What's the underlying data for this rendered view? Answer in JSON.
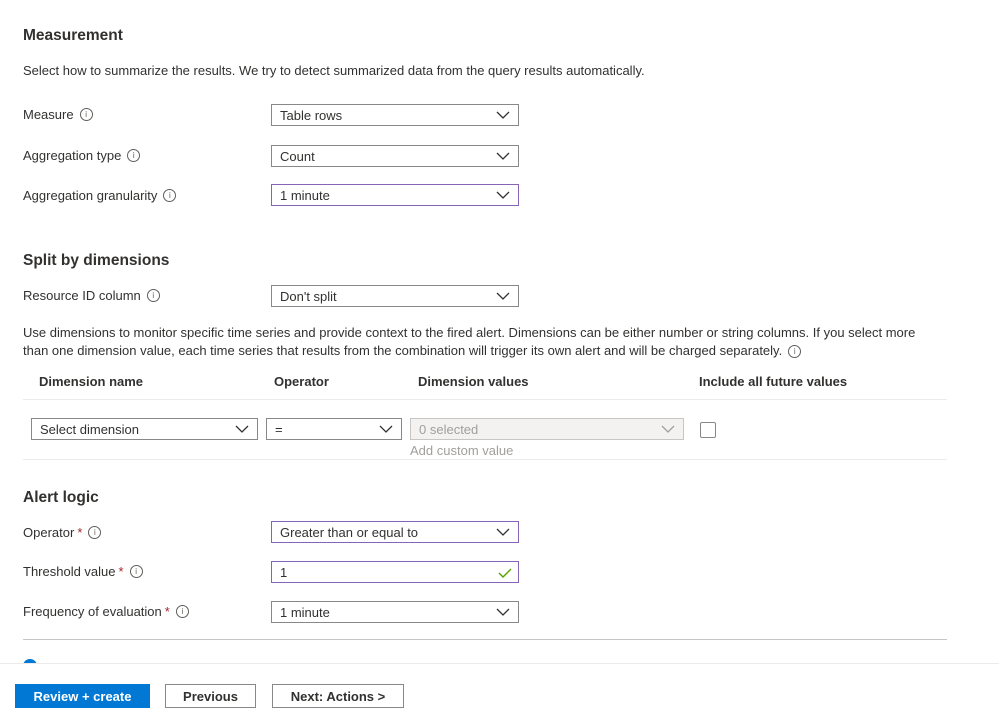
{
  "measurement": {
    "title": "Measurement",
    "description": "Select how to summarize the results. We try to detect summarized data from the query results automatically.",
    "measure": {
      "label": "Measure",
      "value": "Table rows"
    },
    "aggregation_type": {
      "label": "Aggregation type",
      "value": "Count"
    },
    "aggregation_granularity": {
      "label": "Aggregation granularity",
      "value": "1 minute"
    }
  },
  "split": {
    "title": "Split by dimensions",
    "resource_id": {
      "label": "Resource ID column",
      "value": "Don't split"
    },
    "description_line1": "Use dimensions to monitor specific time series and provide context to the fired alert. Dimensions can be either number or string columns. If you select more",
    "description_line2": "than one dimension value, each time series that results from the combination will trigger its own alert and will be charged separately.",
    "table": {
      "headers": {
        "name": "Dimension name",
        "operator": "Operator",
        "values": "Dimension values",
        "future": "Include all future values"
      },
      "row": {
        "name_placeholder": "Select dimension",
        "operator": "=",
        "values": "0 selected",
        "add_custom": "Add custom value"
      }
    }
  },
  "alert_logic": {
    "title": "Alert logic",
    "operator": {
      "label": "Operator",
      "required": "*",
      "value": "Greater than or equal to"
    },
    "threshold": {
      "label": "Threshold value",
      "required": "*",
      "value": "1"
    },
    "frequency": {
      "label": "Frequency of evaluation",
      "required": "*",
      "value": "1 minute"
    }
  },
  "footer": {
    "review_create": "Review + create",
    "previous": "Previous",
    "next": "Next: Actions >"
  },
  "colors": {
    "primary": "#0078d4",
    "focus_border": "#8764b8",
    "required": "#a4262c",
    "valid_check": "#57a300"
  }
}
